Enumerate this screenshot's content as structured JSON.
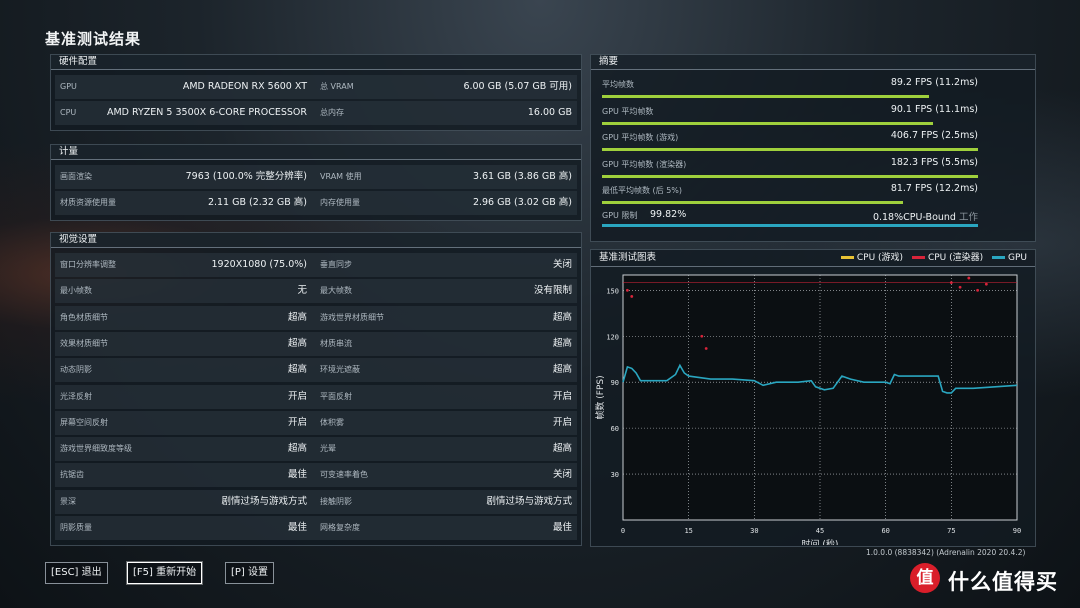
{
  "title": "基准测试结果",
  "hardware": {
    "header": "硬件配置",
    "rows": [
      {
        "l1": "GPU",
        "v1": "AMD RADEON RX 5600 XT",
        "l2": "总 VRAM",
        "v2": "6.00 GB (5.07 GB 可用)"
      },
      {
        "l1": "CPU",
        "v1": "AMD RYZEN 5 3500X 6-CORE PROCESSOR",
        "l2": "总内存",
        "v2": "16.00 GB"
      }
    ]
  },
  "metrics": {
    "header": "计量",
    "rows": [
      {
        "l1": "画面渲染",
        "v1": "7963 (100.0% 完整分辨率)",
        "l2": "VRAM 使用",
        "v2": "3.61 GB (3.86 GB 高)"
      },
      {
        "l1": "材质资源使用量",
        "v1": "2.11 GB (2.32 GB 高)",
        "l2": "内存使用量",
        "v2": "2.96 GB (3.02 GB 高)"
      }
    ]
  },
  "visual": {
    "header": "视觉设置",
    "rows": [
      {
        "l1": "窗口分辨率调整",
        "v1": "1920X1080 (75.0%)",
        "l2": "垂直同步",
        "v2": "关闭"
      },
      {
        "l1": "最小帧数",
        "v1": "无",
        "l2": "最大帧数",
        "v2": "没有限制"
      },
      {
        "l1": "角色材质细节",
        "v1": "超高",
        "l2": "游戏世界材质细节",
        "v2": "超高"
      },
      {
        "l1": "效果材质细节",
        "v1": "超高",
        "l2": "材质串流",
        "v2": "超高"
      },
      {
        "l1": "动态阴影",
        "v1": "超高",
        "l2": "环境光遮蔽",
        "v2": "超高"
      },
      {
        "l1": "光泽反射",
        "v1": "开启",
        "l2": "平面反射",
        "v2": "开启"
      },
      {
        "l1": "屏幕空间反射",
        "v1": "开启",
        "l2": "体积雾",
        "v2": "开启"
      },
      {
        "l1": "游戏世界细致度等级",
        "v1": "超高",
        "l2": "光晕",
        "v2": "超高"
      },
      {
        "l1": "抗锯齿",
        "v1": "最佳",
        "l2": "可变速率着色",
        "v2": "关闭"
      },
      {
        "l1": "景深",
        "v1": "剧情过场与游戏方式",
        "l2": "接触阴影",
        "v2": "剧情过场与游戏方式"
      },
      {
        "l1": "阴影质量",
        "v1": "最佳",
        "l2": "网格复杂度",
        "v2": "最佳"
      }
    ]
  },
  "summary": {
    "header": "摘要",
    "rows": [
      {
        "label": "平均帧数",
        "value": "89.2 FPS (11.2ms)",
        "fill": 0.87
      },
      {
        "label": "GPU 平均帧数",
        "value": "90.1 FPS (11.1ms)",
        "fill": 0.88
      },
      {
        "label": "GPU 平均帧数 (游戏)",
        "value": "406.7 FPS (2.5ms)",
        "fill": 1.0
      },
      {
        "label": "GPU 平均帧数 (渲染器)",
        "value": "182.3 FPS (5.5ms)",
        "fill": 1.0
      },
      {
        "label": "最低平均帧数 (后 5%)",
        "value": "81.7 FPS (12.2ms)",
        "fill": 0.8
      }
    ],
    "gpu_limit": {
      "label": "GPU 限制",
      "percent": "99.82%",
      "cpu_pct": "0.18%",
      "cpu_text": "CPU-Bound",
      "cpu_suffix": "工作"
    }
  },
  "chart_panel": {
    "header": "基准测试图表",
    "legend": [
      {
        "name": "CPU (游戏)",
        "color": "#e8c234"
      },
      {
        "name": "CPU (渲染器)",
        "color": "#d8243a"
      },
      {
        "name": "GPU",
        "color": "#2aa6c0"
      }
    ]
  },
  "chart_data": {
    "type": "line",
    "xlabel": "时间 (秒)",
    "ylabel": "帧数 (FPS)",
    "xlim": [
      0,
      90
    ],
    "ylim": [
      0,
      160
    ],
    "xticks": [
      0,
      15,
      30,
      45,
      60,
      75,
      90
    ],
    "yticks": [
      30,
      60,
      90,
      120,
      150
    ],
    "grid": true,
    "series": [
      {
        "name": "GPU",
        "color": "#2aa6c0",
        "x": [
          0,
          1,
          2,
          3,
          4,
          5,
          10,
          12,
          13,
          14,
          15,
          20,
          25,
          30,
          32,
          35,
          40,
          43,
          44,
          46,
          48,
          50,
          52,
          55,
          60,
          61,
          62,
          63,
          65,
          70,
          72,
          73,
          74,
          75,
          76,
          80,
          85,
          90
        ],
        "y": [
          90,
          100,
          99,
          96,
          91,
          91,
          91,
          95,
          101,
          96,
          94,
          92,
          92,
          91,
          88,
          90,
          90,
          91,
          87,
          85,
          86,
          94,
          92,
          90,
          90,
          89,
          95,
          94,
          94,
          94,
          94,
          84,
          83,
          83,
          86,
          86,
          87,
          88
        ]
      },
      {
        "name": "CPU (渲染器)",
        "color": "#d8243a",
        "x": [
          1,
          2,
          18,
          19,
          75,
          77,
          79,
          81,
          83
        ],
        "y": [
          150,
          146,
          120,
          112,
          155,
          152,
          158,
          150,
          154
        ]
      }
    ]
  },
  "buttons": {
    "esc": "[ESC] 退出",
    "f5": "[F5] 重新开始",
    "p": "[P] 设置"
  },
  "version": "1.0.0.0 (8838342) (Adrenalin 2020 20.4.2)",
  "brand": {
    "logo": "值",
    "text": "什么值得买"
  }
}
